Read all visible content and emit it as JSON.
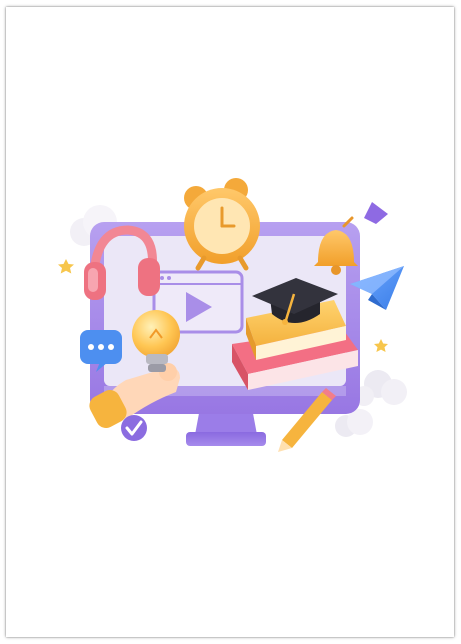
{
  "scene": {
    "subject": "online-learning-3d-illustration",
    "colors": {
      "page_background": "#ffffff",
      "monitor_frame": "#a98ee8",
      "monitor_screen": "#ece8f8",
      "monitor_stand": "#8f6fe3",
      "accent_orange": "#f6b43e",
      "accent_pink": "#f27d8a",
      "paper_plane": "#4f8ff2",
      "graduation_cap": "#2b2b35",
      "chat_bubble": "#4d8ff0"
    },
    "icons": [
      "alarm-clock-icon",
      "headphones-icon",
      "bell-icon",
      "play-window-icon",
      "graduation-cap-icon",
      "books-icon",
      "lightbulb-icon",
      "hand-icon",
      "checkmark-icon",
      "chat-bubble-icon",
      "pencil-icon",
      "paper-plane-icon",
      "star-icon",
      "cloud-icon"
    ]
  }
}
